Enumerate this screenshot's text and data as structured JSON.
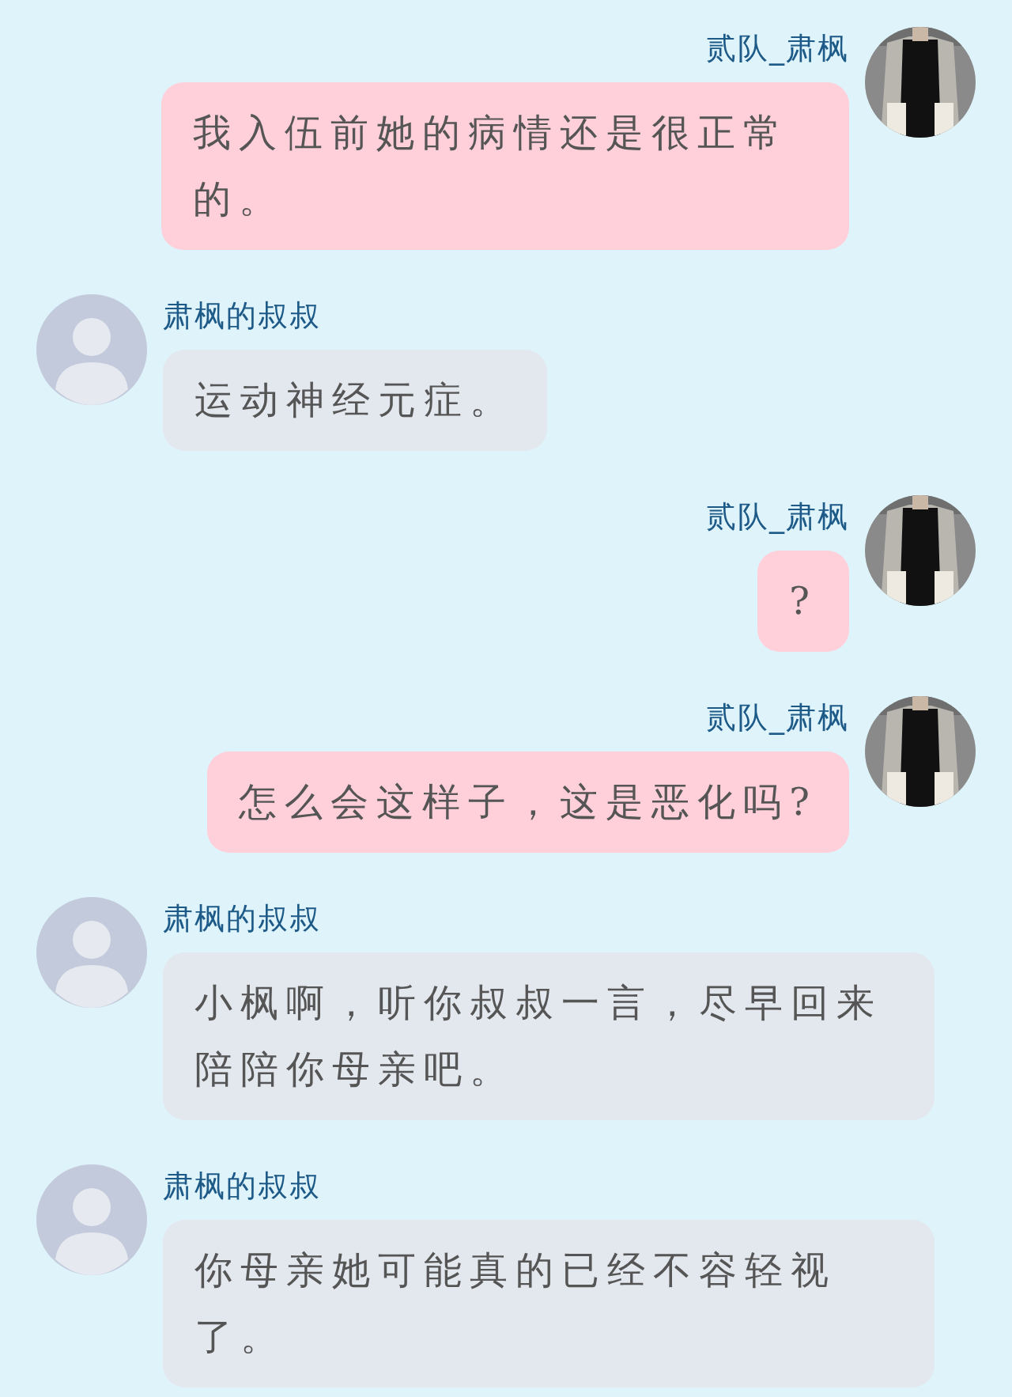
{
  "messages": [
    {
      "kind": "sent",
      "sender": "贰队_肃枫",
      "text": "我入伍前她的病情还是很正常的。"
    },
    {
      "kind": "received",
      "sender": "肃枫的叔叔",
      "text": "运动神经元症。"
    },
    {
      "kind": "sent",
      "sender": "贰队_肃枫",
      "text": "?"
    },
    {
      "kind": "sent",
      "sender": "贰队_肃枫",
      "text": "怎么会这样子，这是恶化吗?"
    },
    {
      "kind": "received",
      "sender": "肃枫的叔叔",
      "text": "小枫啊，听你叔叔一言，尽早回来陪陪你母亲吧。"
    },
    {
      "kind": "received",
      "sender": "肃枫的叔叔",
      "text": "你母亲她可能真的已经不容轻视了。"
    }
  ]
}
